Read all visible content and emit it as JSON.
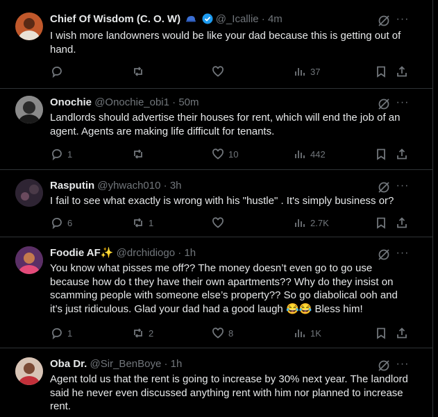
{
  "posts": [
    {
      "name": "Chief Of Wisdom (C. O. W)",
      "handle": "@_Icallie",
      "time": "4m",
      "text": "I wish more landowners would be like your dad because this is getting out of hand.",
      "replies": "",
      "reposts": "",
      "likes": "",
      "views": "37",
      "badges": [
        "cap-emoji",
        "verified-badge"
      ],
      "avatar_color": "#c0582b"
    },
    {
      "name": "Onochie",
      "handle": "@Onochie_obi1",
      "time": "50m",
      "text": "Landlords should advertise their houses for rent, which will end the job of an agent. Agents are making life difficult for tenants.",
      "replies": "1",
      "reposts": "",
      "likes": "10",
      "views": "442",
      "avatar_color": "#6b6b6b"
    },
    {
      "name": "Rasputin",
      "handle": "@yhwach010",
      "time": "3h",
      "text": "I fail to see what exactly is wrong with his \"hustle\" . It's simply business or?",
      "replies": "6",
      "reposts": "1",
      "likes": "",
      "views": "2.7K",
      "avatar_color": "#3c2f3f"
    },
    {
      "name": "Foodie AF",
      "name_emoji": "✨",
      "handle": "@drchidiogo",
      "time": "1h",
      "text": "You know what pisses me off?? The money doesn’t even go to go use because how do t they have their own apartments?? Why do they insist on scamming people with someone else’s property?? So go diabolical ooh and it’s just ridiculous. Glad your dad had a good laugh 😂😂 Bless him!",
      "replies": "1",
      "reposts": "2",
      "likes": "8",
      "views": "1K",
      "avatar_color": "#7a3a5a"
    },
    {
      "name": "Oba Dr.",
      "handle": "@Sir_BenBoye",
      "time": "1h",
      "text": "Agent told us that the rent is going to increase by 30% next year. The landlord said he never even discussed anything rent with him nor planned to increase rent.",
      "avatar_color": "#b8745a"
    }
  ],
  "ui": {
    "more_label": "···",
    "dot": "·",
    "icons": [
      "reply-icon",
      "repost-icon",
      "like-icon",
      "views-icon",
      "bookmark-icon",
      "share-icon",
      "grok-icon",
      "more-icon"
    ],
    "accent": "#1d9bf0",
    "muted": "#71767b",
    "border": "#2f3336"
  }
}
